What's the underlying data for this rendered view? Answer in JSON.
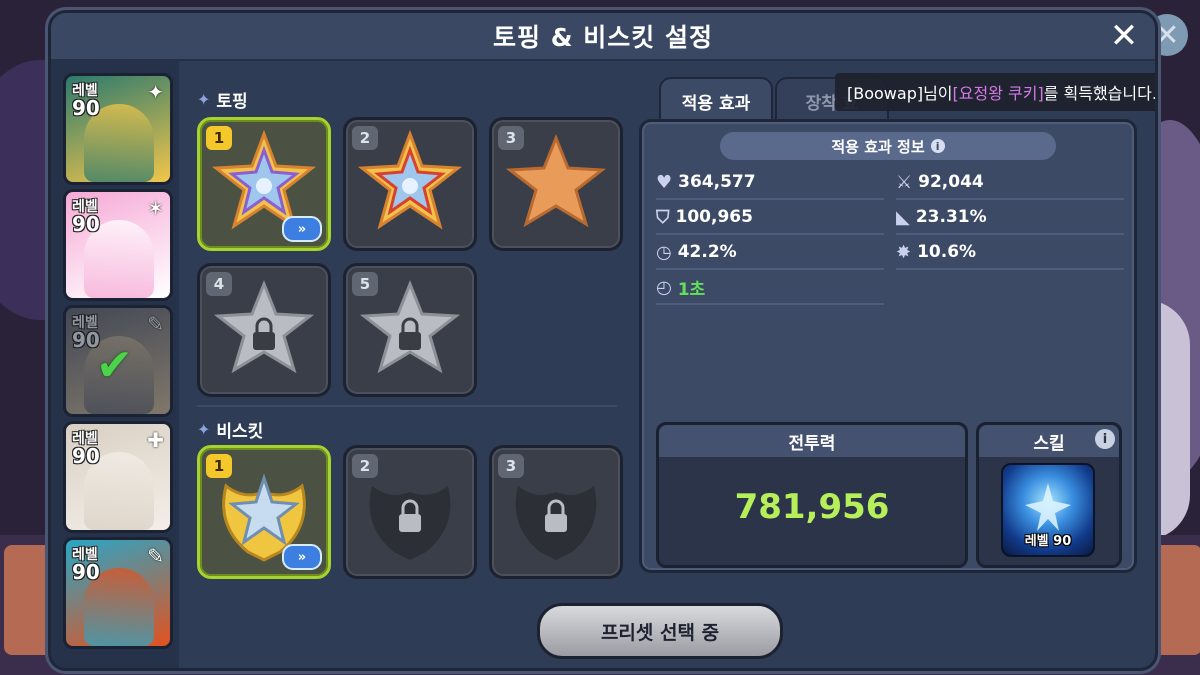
{
  "title": "토핑 & 비스킷 설정",
  "close_label": "✕",
  "cookies": [
    {
      "level_word": "레벨",
      "level": "90",
      "corner_icon": "✦",
      "color_a": "#2c7a6e",
      "color_b": "#f2c64a",
      "selected": false
    },
    {
      "level_word": "레벨",
      "level": "90",
      "corner_icon": "✶",
      "color_a": "#f6a9d6",
      "color_b": "#ffffff",
      "selected": false
    },
    {
      "level_word": "레벨",
      "level": "90",
      "corner_icon": "✎",
      "color_a": "#6a6f7c",
      "color_b": "#d8c7a0",
      "selected": true
    },
    {
      "level_word": "레벨",
      "level": "90",
      "corner_icon": "✚",
      "color_a": "#d9d0c4",
      "color_b": "#f3efe8",
      "selected": false
    },
    {
      "level_word": "레벨",
      "level": "90",
      "corner_icon": "✎",
      "color_a": "#2aa6c6",
      "color_b": "#e4511e",
      "selected": false
    }
  ],
  "toppings_label": "토핑",
  "toppings": [
    {
      "num": "1",
      "state": "equipped",
      "active": true,
      "has_forward": true
    },
    {
      "num": "2",
      "state": "equipped",
      "active": false,
      "has_forward": false
    },
    {
      "num": "3",
      "state": "empty",
      "active": false,
      "has_forward": false
    },
    {
      "num": "4",
      "state": "locked",
      "active": false,
      "has_forward": false
    },
    {
      "num": "5",
      "state": "locked",
      "active": false,
      "has_forward": false
    }
  ],
  "biscuits_label": "비스킷",
  "biscuits": [
    {
      "num": "1",
      "state": "equipped",
      "active": true,
      "has_forward": true
    },
    {
      "num": "2",
      "state": "locked",
      "active": false,
      "has_forward": false
    },
    {
      "num": "3",
      "state": "locked",
      "active": false,
      "has_forward": false
    }
  ],
  "forward_label": "»",
  "tabs": {
    "active": "적용 효과",
    "inactive": "장착 효"
  },
  "toast": {
    "prefix": "[Boowap]님이 ",
    "highlight": "[요정왕 쿠키]",
    "suffix": "를 획득했습니다."
  },
  "panel": {
    "title": "적용 효과 정보",
    "info_icon": "i",
    "stats_left": [
      {
        "icon": "heart-icon",
        "value": "364,577",
        "green": false
      },
      {
        "icon": "shield-icon",
        "value": "100,965",
        "green": false
      },
      {
        "icon": "cooldown-icon",
        "value": "42.2%",
        "green": false
      },
      {
        "icon": "clock-icon",
        "value": "1초",
        "green": true
      }
    ],
    "stats_right": [
      {
        "icon": "sword-icon",
        "value": "92,044"
      },
      {
        "icon": "critical-icon",
        "value": "23.31%"
      },
      {
        "icon": "burst-icon",
        "value": "10.6%"
      }
    ]
  },
  "power": {
    "label": "전투력",
    "value": "781,956"
  },
  "skill": {
    "label": "스킬",
    "level": "레벨 90",
    "info_icon": "i"
  },
  "preset_label": "프리셋 선택 중",
  "colors": {
    "accent_green": "#a6d32e",
    "power_green": "#b6ef5a",
    "toast_purple": "#d47ae6"
  }
}
